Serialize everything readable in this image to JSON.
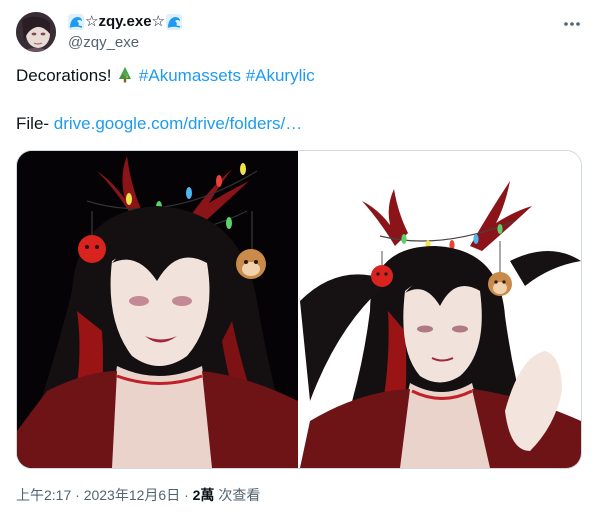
{
  "author": {
    "display_name": "☆zqy.exe☆",
    "handle": "@zqy_exe"
  },
  "more_icon": "more-horizontal-icon",
  "tweet": {
    "line1_text": "Decorations! ",
    "line1_emoji": "christmas-tree",
    "hashtag1": "#Akumassets",
    "hashtag2": "#Akurylic",
    "file_prefix": "File- ",
    "file_link": "drive.google.com/drive/folders/…"
  },
  "meta": {
    "timestamp": "上午2:17 · 2023年12月6日 · ",
    "views_count": "2萬",
    "views_label": " 次查看"
  },
  "colors": {
    "link": "#1d9bf0",
    "text": "#0f1419",
    "secondary": "#536471",
    "border": "#cfd9de"
  }
}
